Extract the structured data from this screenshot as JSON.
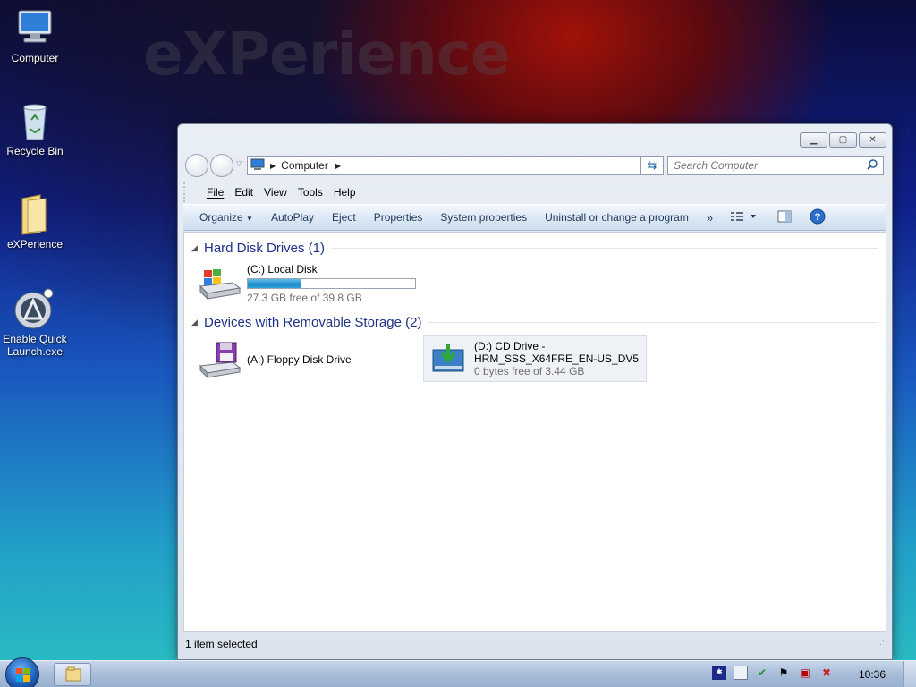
{
  "wallpaper": {
    "text": "eXPerience"
  },
  "desktop": {
    "icons": [
      {
        "label": "Computer",
        "icon": "computer-icon"
      },
      {
        "label": "Recycle Bin",
        "icon": "recycle-bin-icon"
      },
      {
        "label": "eXPerience",
        "icon": "folder-icon"
      },
      {
        "label": "Enable Quick Launch.exe",
        "icon": "quick-launch-icon"
      }
    ]
  },
  "window": {
    "address": {
      "crumb": "Computer"
    },
    "search": {
      "placeholder": "Search Computer"
    },
    "menu": [
      "File",
      "Edit",
      "View",
      "Tools",
      "Help"
    ],
    "commands": {
      "organize": "Organize",
      "autoplay": "AutoPlay",
      "eject": "Eject",
      "properties": "Properties",
      "system_properties": "System properties",
      "uninstall": "Uninstall or change a program",
      "more": "»"
    },
    "groups": {
      "hard_disk": {
        "title": "Hard Disk Drives (1)",
        "drive": {
          "name": "(C:) Local Disk",
          "free_text": "27.3 GB free of 39.8 GB",
          "used_fraction": 0.314
        }
      },
      "removable": {
        "title": "Devices with Removable Storage (2)",
        "floppy": {
          "name": "(A:) Floppy Disk Drive"
        },
        "cd": {
          "name_line1": "(D:) CD Drive -",
          "name_line2": "HRM_SSS_X64FRE_EN-US_DV5",
          "free_text": "0 bytes free of 3.44 GB"
        }
      }
    },
    "status": "1 item selected"
  },
  "taskbar": {
    "clock": "10:36"
  },
  "colors": {
    "accent": "#1e3287",
    "bar": "#1e88c9"
  }
}
